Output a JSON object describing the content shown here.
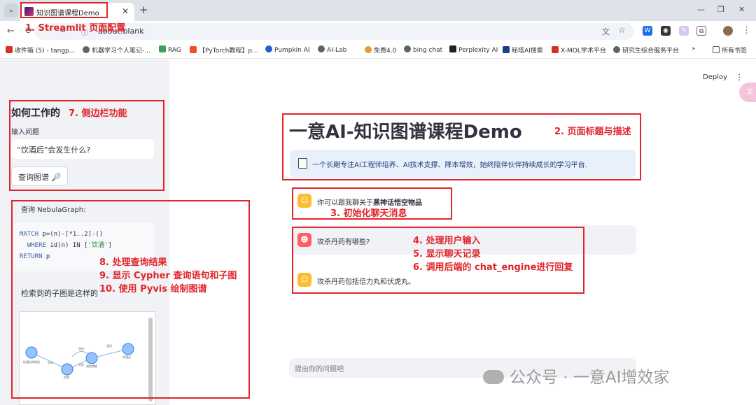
{
  "browser": {
    "tab_title": "知识图谱课程Demo",
    "url": "about:blank",
    "bookmarks": [
      {
        "label": "收件箱 (5) - tangp...",
        "color": "#d93025"
      },
      {
        "label": "机器学习个人笔记-...",
        "color": "#5f6368"
      },
      {
        "label": "RAG",
        "color": "#3aa35a"
      },
      {
        "label": "【PyTorch教程】p...",
        "color": "#f25022"
      },
      {
        "label": "Pumpkin AI",
        "color": "#2a5bd7"
      },
      {
        "label": "AI-Lab",
        "color": "#5f6368"
      },
      {
        "label": "免费4.0",
        "color": "#e59c2c"
      },
      {
        "label": "bing chat",
        "color": "#5f6368"
      },
      {
        "label": "Perplexity AI",
        "color": "#222222"
      },
      {
        "label": "秘塔AI搜索",
        "color": "#1b3c8f"
      },
      {
        "label": "X-MOL学术平台",
        "color": "#d93025"
      },
      {
        "label": "研究生综合服务平台",
        "color": "#5f6368"
      }
    ],
    "all_bookmarks": "所有书签"
  },
  "sidebar": {
    "title": "如何工作的",
    "input_label": "输入问题",
    "input_value": "“饮酒后”会发生什么?",
    "query_button": "查询图谱 🔎",
    "query_label": "查询 NebulaGraph:",
    "code": {
      "line1_kw": "MATCH",
      "line1_rest": " p=(n)-[*1..2]-()",
      "line2_kw": "  WHERE",
      "line2_mid": " id(n) IN [",
      "line2_str": "'饮酒'",
      "line2_end": "]",
      "line3_kw": "RETURN",
      "line3_rest": " p"
    },
    "subgraph_label": "检索到的子图是这样的",
    "graph": {
      "nodes": [
        "饮酒后的危险",
        "饮酒",
        "诱发病症",
        "服用",
        "饮酒过"
      ],
      "edges": [
        "导致",
        "导致",
        "服用",
        "服用"
      ]
    }
  },
  "main": {
    "deploy": "Deploy",
    "title": "一意AI-知识图谱课程Demo",
    "info": "一个长期专注AI工程师培养、AI技术支撑、降本增效，始终陪伴伙伴持续成长的学习平台.",
    "messages": [
      {
        "role": "assistant",
        "text": "你可以跟我聊关于",
        "bold": "黑神话悟空物品"
      },
      {
        "role": "user",
        "text": "攻杀丹药有哪些?"
      },
      {
        "role": "assistant",
        "text": "攻杀丹药包括倍力丸和伏虎丸。"
      }
    ],
    "chat_placeholder": "提出你的问题吧"
  },
  "annotations": {
    "a1": "1. Streamlit 页面配置",
    "a2": "2. 页面标题与描述",
    "a3": "3. 初始化聊天消息",
    "a4": "4. 处理用户输入",
    "a5": "5. 显示聊天记录",
    "a6": "6. 调用后端的 chat_engine进行回复",
    "a7": "7. 侧边栏功能",
    "a8": "8. 处理查询结果",
    "a9": "9. 显示 Cypher 查询语句和子图",
    "a10": "10. 使用 Pyvis 绘制图谱",
    "color": "#e0252b"
  },
  "watermark": "公众号 · 一意AI增效家"
}
